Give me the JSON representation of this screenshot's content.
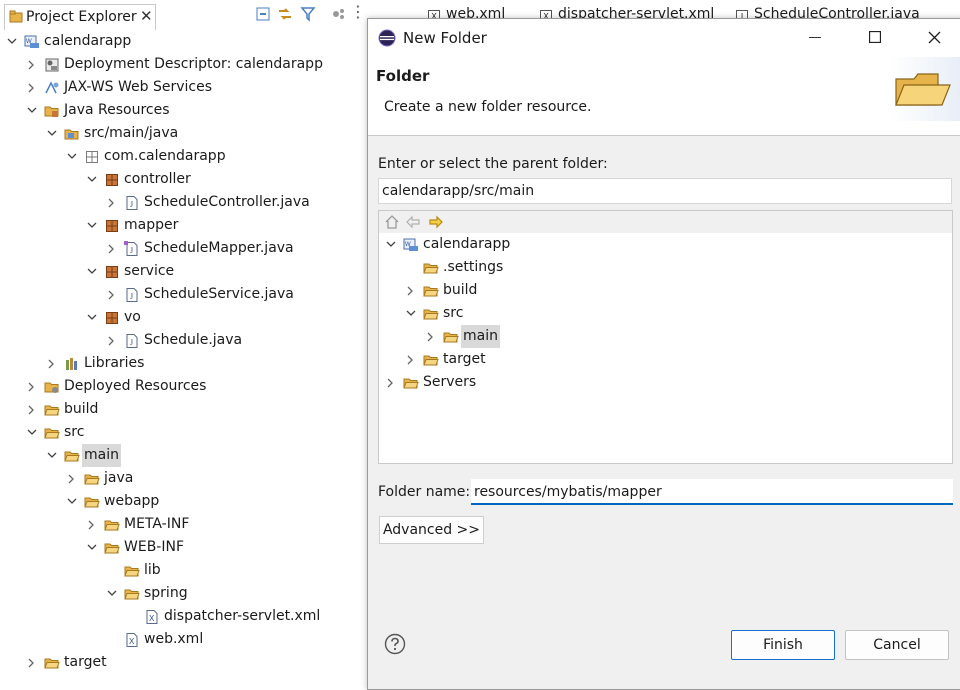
{
  "explorer": {
    "tab_label": "Project Explorer",
    "tab_close": "✕",
    "tree": [
      {
        "label": "calendarapp",
        "depth": 0,
        "twisty": "open",
        "icon": "project-icon"
      },
      {
        "label": "Deployment Descriptor: calendarapp",
        "depth": 1,
        "twisty": "closed",
        "icon": "deployment-descriptor-icon"
      },
      {
        "label": "JAX-WS Web Services",
        "depth": 1,
        "twisty": "closed",
        "icon": "web-services-icon"
      },
      {
        "label": "Java Resources",
        "depth": 1,
        "twisty": "open",
        "icon": "java-resources-icon"
      },
      {
        "label": "src/main/java",
        "depth": 2,
        "twisty": "open",
        "icon": "source-folder-icon"
      },
      {
        "label": "com.calendarapp",
        "depth": 3,
        "twisty": "open",
        "icon": "package-empty-icon"
      },
      {
        "label": "controller",
        "depth": 4,
        "twisty": "open",
        "icon": "package-icon"
      },
      {
        "label": "ScheduleController.java",
        "depth": 5,
        "twisty": "closed",
        "icon": "java-file-icon"
      },
      {
        "label": "mapper",
        "depth": 4,
        "twisty": "open",
        "icon": "package-icon"
      },
      {
        "label": "ScheduleMapper.java",
        "depth": 5,
        "twisty": "closed",
        "icon": "java-interface-file-icon"
      },
      {
        "label": "service",
        "depth": 4,
        "twisty": "open",
        "icon": "package-icon"
      },
      {
        "label": "ScheduleService.java",
        "depth": 5,
        "twisty": "closed",
        "icon": "java-file-icon"
      },
      {
        "label": "vo",
        "depth": 4,
        "twisty": "open",
        "icon": "package-icon"
      },
      {
        "label": "Schedule.java",
        "depth": 5,
        "twisty": "closed",
        "icon": "java-file-icon"
      },
      {
        "label": "Libraries",
        "depth": 2,
        "twisty": "closed",
        "icon": "libraries-icon"
      },
      {
        "label": "Deployed Resources",
        "depth": 1,
        "twisty": "closed",
        "icon": "deployed-resources-icon"
      },
      {
        "label": "build",
        "depth": 1,
        "twisty": "closed",
        "icon": "folder-icon"
      },
      {
        "label": "src",
        "depth": 1,
        "twisty": "open",
        "icon": "folder-icon"
      },
      {
        "label": "main",
        "depth": 2,
        "twisty": "open",
        "icon": "folder-icon",
        "selected": true
      },
      {
        "label": "java",
        "depth": 3,
        "twisty": "closed",
        "icon": "folder-icon"
      },
      {
        "label": "webapp",
        "depth": 3,
        "twisty": "open",
        "icon": "folder-icon"
      },
      {
        "label": "META-INF",
        "depth": 4,
        "twisty": "closed",
        "icon": "folder-icon"
      },
      {
        "label": "WEB-INF",
        "depth": 4,
        "twisty": "open",
        "icon": "folder-icon"
      },
      {
        "label": "lib",
        "depth": 5,
        "twisty": "none",
        "icon": "folder-icon"
      },
      {
        "label": "spring",
        "depth": 5,
        "twisty": "open",
        "icon": "folder-icon"
      },
      {
        "label": "dispatcher-servlet.xml",
        "depth": 6,
        "twisty": "none",
        "icon": "xml-file-icon"
      },
      {
        "label": "web.xml",
        "depth": 5,
        "twisty": "none",
        "icon": "xml-file-icon"
      },
      {
        "label": "target",
        "depth": 1,
        "twisty": "closed",
        "icon": "folder-icon"
      }
    ]
  },
  "editor_tabs": [
    {
      "label": "web.xml"
    },
    {
      "label": "dispatcher-servlet.xml"
    },
    {
      "label": "ScheduleController.java"
    }
  ],
  "dialog": {
    "title": "New Folder",
    "banner_title": "Folder",
    "banner_description": "Create a new folder resource.",
    "parent_label": "Enter or select the parent folder:",
    "parent_value": "calendarapp/src/main",
    "tree": [
      {
        "label": "calendarapp",
        "depth": 0,
        "twisty": "open",
        "icon": "project-icon"
      },
      {
        "label": ".settings",
        "depth": 1,
        "twisty": "none",
        "icon": "folder-icon"
      },
      {
        "label": "build",
        "depth": 1,
        "twisty": "closed",
        "icon": "folder-icon"
      },
      {
        "label": "src",
        "depth": 1,
        "twisty": "open",
        "icon": "folder-icon"
      },
      {
        "label": "main",
        "depth": 2,
        "twisty": "closed",
        "icon": "folder-icon",
        "selected": true
      },
      {
        "label": "target",
        "depth": 1,
        "twisty": "closed",
        "icon": "folder-icon"
      },
      {
        "label": "Servers",
        "depth": 0,
        "twisty": "closed",
        "icon": "folder-icon"
      }
    ],
    "folder_name_label": "Folder name:",
    "folder_name_value": "resources/mybatis/mapper",
    "advanced_label": "Advanced >>",
    "finish_label": "Finish",
    "cancel_label": "Cancel"
  },
  "colors": {
    "folder": "#e8b44a",
    "package": "#a0522d",
    "focus": "#0067c0",
    "selection": "#d9d9d9"
  }
}
